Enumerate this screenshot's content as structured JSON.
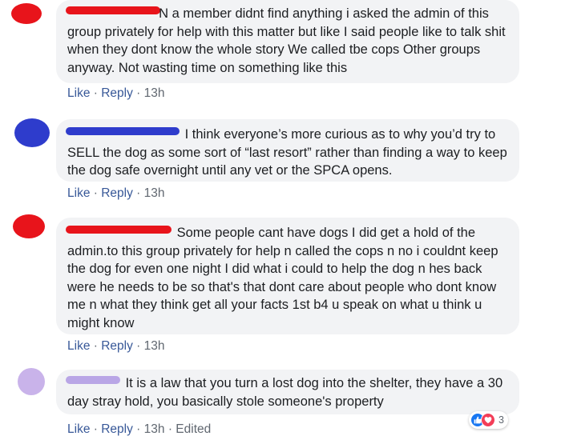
{
  "colors": {
    "link": "#385898",
    "meta": "#606770",
    "bubble": "#f2f3f5",
    "text": "#1c1e21",
    "like_blue": "#1877f2",
    "love_red": "#f33e58"
  },
  "action_labels": {
    "like": "Like",
    "reply": "Reply",
    "separator": "·"
  },
  "comments": [
    {
      "avatar_color": "#e8141b",
      "author_name_redacted": true,
      "author_initial": "N",
      "redaction_color": "#e8141b",
      "text": "a member didnt find anything i asked the admin of this group privately for help with this matter but like I said people like to talk shit when they dont know the whole story We called tbe cops Other groups anyway. Not wasting time on something like this",
      "time": "13h"
    },
    {
      "avatar_color": "#2e3ccc",
      "author_name_redacted": true,
      "redaction_color": "#2e3ccc",
      "text": "I think everyone’s more curious as to why you’d try to SELL the dog as some sort of “last resort” rather than finding a way to keep the dog safe overnight until any vet or the SPCA opens.",
      "time": "13h"
    },
    {
      "avatar_color": "#e8141b",
      "author_name_redacted": true,
      "redaction_color": "#e8141b",
      "text": "Some people cant have dogs I did get a hold of the admin.to this group privately for help n called the cops n no i couldnt keep the dog for even one night I did what i could to help the dog n hes back were he needs to be so that's that dont care about people who dont know me n what they think get all your facts 1st b4 u speak on what u think u might know",
      "time": "13h"
    },
    {
      "avatar_color": "#c9b3ea",
      "author_name_redacted": true,
      "redaction_color": "#b9a6e6",
      "text": "It is a law that you turn a lost dog into the shelter, they have a 30 day stray hold, you basically stole someone's property",
      "time": "13h",
      "edited": "Edited",
      "reactions": {
        "icons": [
          "like-icon",
          "love-icon"
        ],
        "count": "3"
      }
    }
  ]
}
